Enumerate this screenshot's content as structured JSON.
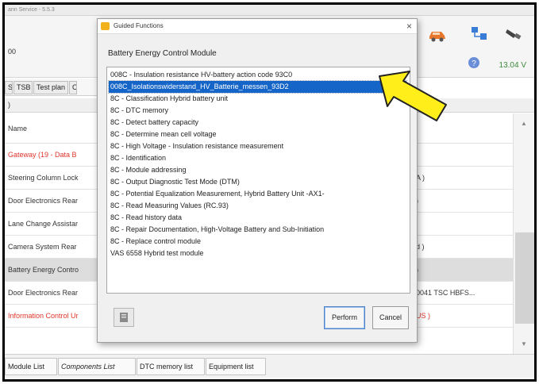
{
  "app": {
    "title_text": "ann Service - 5.5.3",
    "vehicle_id": "00",
    "battery_voltage": "13.04 V"
  },
  "tabs": [
    "S",
    "TSB",
    "Test plan",
    "O"
  ],
  "list_header": ")",
  "column_header": "Name",
  "rows": [
    {
      "name": "Gateway (19 - Data B",
      "right": "",
      "red": true,
      "selected": false
    },
    {
      "name": "Steering Column Lock",
      "right": "A )",
      "red": false,
      "selected": false
    },
    {
      "name": "Door Electronics Rear",
      "right": ")",
      "red": false,
      "selected": false
    },
    {
      "name": "Lane Change Assistar",
      "right": "",
      "red": false,
      "selected": false
    },
    {
      "name": "Camera System Rear",
      "right": "d )",
      "red": false,
      "selected": false
    },
    {
      "name": "Battery Energy Contro",
      "right": ")",
      "red": false,
      "selected": true
    },
    {
      "name": "Door Electronics Rear",
      "right": "0041  TSC HBFS...",
      "red": false,
      "selected": false
    },
    {
      "name": "Information Control Ur",
      "right": "US )",
      "red": true,
      "selected": false
    }
  ],
  "bottom_tabs": [
    {
      "label": "Module List",
      "italic": false
    },
    {
      "label": "Components List",
      "italic": true
    },
    {
      "label": "DTC memory list",
      "italic": false
    },
    {
      "label": "Equipment list",
      "italic": false
    }
  ],
  "dialog": {
    "title": "Guided Functions",
    "close_glyph": "×",
    "heading": "Battery Energy Control Module",
    "items": [
      "008C - Insulation resistance HV-battery action code 93C0",
      "008C_Isolationswiderstand_HV_Batterie_messen_93D2",
      "8C - Classification Hybrid battery unit",
      "8C - DTC memory",
      "8C - Detect battery capacity",
      "8C - Determine mean cell voltage",
      "8C - High Voltage - Insulation resistance measurement",
      "8C - Identification",
      "8C - Module addressing",
      "8C - Output Diagnostic Test Mode (DTM)",
      "8C - Potential Equalization Measurement, Hybrid Battery Unit -AX1-",
      "8C - Read Measuring Values (RC.93)",
      "8C - Read history data",
      "8C - Repair Documentation, High-Voltage Battery and Sub-Initiation",
      "8C - Replace control module",
      "VAS 6558 Hybrid test module"
    ],
    "selected_index": 1,
    "perform_label": "Perform",
    "cancel_label": "Cancel"
  },
  "colors": {
    "selection": "#1565c8",
    "arrow_fill": "#ffee1a",
    "error_text": "#e0352b",
    "voltage_text": "#3c8c3c"
  },
  "icons": [
    "car-icon",
    "network-icon",
    "plug-icon",
    "help-icon",
    "app-icon",
    "close-icon",
    "scroll-up-icon",
    "scroll-down-icon",
    "pointer-arrow-icon"
  ]
}
